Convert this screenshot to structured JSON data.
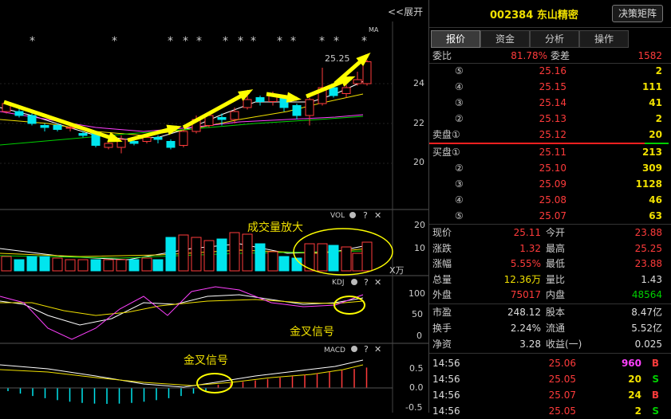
{
  "chart": {
    "expand_label": "<<展开",
    "ma_label": "MA",
    "price_label": "25.25",
    "price_ticks": [
      "24",
      "22",
      "20"
    ],
    "vol_label": "VOL",
    "vol_ticks": [
      "20",
      "10"
    ],
    "vol_unit": "X万",
    "kdj_label": "KDJ",
    "kdj_ticks": [
      "100",
      "50",
      "0"
    ],
    "macd_label": "MACD",
    "macd_ticks": [
      "0.5",
      "0.0",
      "-0.5"
    ],
    "annotation_volume": "成交量放大",
    "annotation_kdj": "金叉信号",
    "annotation_macd": "金叉信号",
    "stars": "*"
  },
  "header": {
    "stock_code": "002384",
    "stock_name": "东山精密",
    "matrix_button": "决策矩阵"
  },
  "tabs": [
    "报价",
    "资金",
    "分析",
    "操作"
  ],
  "order_book": {
    "weibi_label": "委比",
    "weibi_value": "81.78%",
    "weicha_label": "委差",
    "weicha_value": "1582",
    "asks": [
      {
        "label": "⑤",
        "price": "25.16",
        "vol": "2"
      },
      {
        "label": "④",
        "price": "25.15",
        "vol": "111"
      },
      {
        "label": "③",
        "price": "25.14",
        "vol": "41"
      },
      {
        "label": "②",
        "price": "25.13",
        "vol": "2"
      },
      {
        "label": "卖盘①",
        "price": "25.12",
        "vol": "20"
      }
    ],
    "bids": [
      {
        "label": "买盘①",
        "price": "25.11",
        "vol": "213"
      },
      {
        "label": "②",
        "price": "25.10",
        "vol": "309"
      },
      {
        "label": "③",
        "price": "25.09",
        "vol": "1128"
      },
      {
        "label": "④",
        "price": "25.08",
        "vol": "46"
      },
      {
        "label": "⑤",
        "price": "25.07",
        "vol": "63"
      }
    ]
  },
  "quote": [
    {
      "l1": "现价",
      "v1": "25.11",
      "l2": "今开",
      "v2": "23.88",
      "c1": "red",
      "c2": "red"
    },
    {
      "l1": "涨跌",
      "v1": "1.32",
      "l2": "最高",
      "v2": "25.25",
      "c1": "red",
      "c2": "red"
    },
    {
      "l1": "涨幅",
      "v1": "5.55%",
      "l2": "最低",
      "v2": "23.88",
      "c1": "red",
      "c2": "red"
    },
    {
      "l1": "总量",
      "v1": "12.36万",
      "l2": "量比",
      "v2": "1.43",
      "c1": "yellow",
      "c2": "white"
    },
    {
      "l1": "外盘",
      "v1": "75017",
      "l2": "内盘",
      "v2": "48564",
      "c1": "red",
      "c2": "green"
    }
  ],
  "fundamentals": [
    {
      "l1": "市盈",
      "v1": "248.12",
      "l2": "股本",
      "v2": "8.47亿"
    },
    {
      "l1": "换手",
      "v1": "2.24%",
      "l2": "流通",
      "v2": "5.52亿"
    },
    {
      "l1": "净资",
      "v1": "3.28",
      "l2": "收益(一)",
      "v2": "0.025"
    }
  ],
  "ticks": [
    {
      "time": "14:56",
      "price": "25.06",
      "vol": "960",
      "side": "B",
      "vcolor": "#ff40ff"
    },
    {
      "time": "14:56",
      "price": "25.05",
      "vol": "20",
      "side": "S",
      "vcolor": "#f0e000"
    },
    {
      "time": "14:56",
      "price": "25.07",
      "vol": "24",
      "side": "B",
      "vcolor": "#f0e000"
    },
    {
      "time": "14:56",
      "price": "25.05",
      "vol": "2",
      "side": "S",
      "vcolor": "#f0e000"
    }
  ],
  "colors": {
    "up": "#ff3b3b",
    "down": "#00e5ee",
    "ma5": "#ffffff",
    "ma10": "#f0e000",
    "ma20": "#ff40ff",
    "ma60": "#00d000",
    "arrow": "#ffff00"
  }
}
